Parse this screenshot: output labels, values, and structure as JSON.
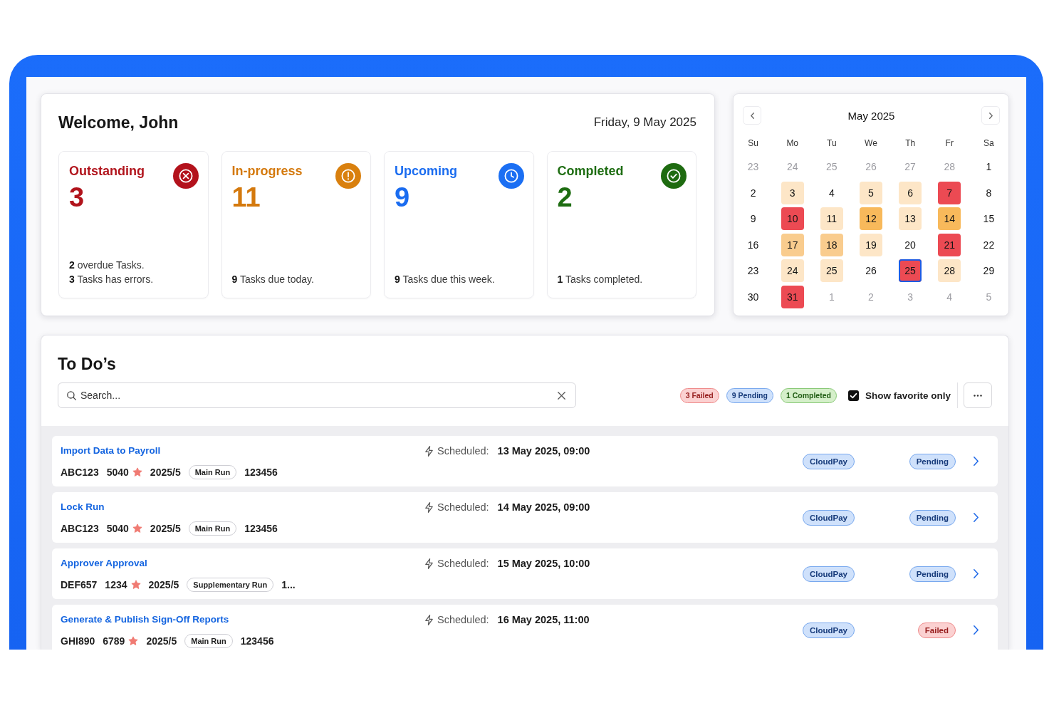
{
  "welcome": {
    "title": "Welcome, John",
    "date": "Friday, 9 May 2025",
    "stats": [
      {
        "kind": "outstanding",
        "label": "Outstanding",
        "value": "3",
        "notes": [
          "**2** overdue Tasks.",
          "**3** Tasks has errors."
        ]
      },
      {
        "kind": "in_progress",
        "label": "In-progress",
        "value": "11",
        "notes": [
          "**9** Tasks due today."
        ]
      },
      {
        "kind": "upcoming",
        "label": "Upcoming",
        "value": "9",
        "notes": [
          "**9** Tasks due this week."
        ]
      },
      {
        "kind": "completed",
        "label": "Completed",
        "value": "2",
        "notes": [
          "**1** Tasks completed."
        ]
      }
    ]
  },
  "calendar": {
    "title": "May 2025",
    "weekdays": [
      "Su",
      "Mo",
      "Tu",
      "We",
      "Th",
      "Fr",
      "Sa"
    ],
    "days": [
      {
        "day": "23",
        "outside": true,
        "selected": false
      },
      {
        "day": "24",
        "outside": true,
        "selected": false
      },
      {
        "day": "25",
        "outside": true,
        "selected": false
      },
      {
        "day": "26",
        "outside": true,
        "selected": false
      },
      {
        "day": "27",
        "outside": true,
        "selected": false
      },
      {
        "day": "28",
        "outside": true,
        "selected": false
      },
      {
        "day": "1",
        "outside": false,
        "selected": false
      },
      {
        "day": "2",
        "outside": false,
        "selected": false
      },
      {
        "day": "3",
        "outside": false,
        "selected": false,
        "color": "#fde6c7"
      },
      {
        "day": "4",
        "outside": false,
        "selected": false
      },
      {
        "day": "5",
        "outside": false,
        "selected": false,
        "color": "#fde6c7"
      },
      {
        "day": "6",
        "outside": false,
        "selected": false,
        "color": "#fde6c7"
      },
      {
        "day": "7",
        "outside": false,
        "selected": false,
        "color": "#ec4a53"
      },
      {
        "day": "8",
        "outside": false,
        "selected": false
      },
      {
        "day": "9",
        "outside": false,
        "selected": false
      },
      {
        "day": "10",
        "outside": false,
        "selected": false,
        "color": "#ec4a53"
      },
      {
        "day": "11",
        "outside": false,
        "selected": false,
        "color": "#fde6c7"
      },
      {
        "day": "12",
        "outside": false,
        "selected": false,
        "color": "#f8b95b"
      },
      {
        "day": "13",
        "outside": false,
        "selected": false,
        "color": "#fde6c7"
      },
      {
        "day": "14",
        "outside": false,
        "selected": false,
        "color": "#f8b95b"
      },
      {
        "day": "15",
        "outside": false,
        "selected": false
      },
      {
        "day": "16",
        "outside": false,
        "selected": false
      },
      {
        "day": "17",
        "outside": false,
        "selected": false,
        "color": "#f9cc8e"
      },
      {
        "day": "18",
        "outside": false,
        "selected": false,
        "color": "#f9cc8e"
      },
      {
        "day": "19",
        "outside": false,
        "selected": false,
        "color": "#fde6c7"
      },
      {
        "day": "20",
        "outside": false,
        "selected": false
      },
      {
        "day": "21",
        "outside": false,
        "selected": false,
        "color": "#ec4a53"
      },
      {
        "day": "22",
        "outside": false,
        "selected": false
      },
      {
        "day": "23",
        "outside": false,
        "selected": false
      },
      {
        "day": "24",
        "outside": false,
        "selected": false,
        "color": "#fde6c7"
      },
      {
        "day": "25",
        "outside": false,
        "selected": false,
        "color": "#fde6c7"
      },
      {
        "day": "26",
        "outside": false,
        "selected": false
      },
      {
        "day": "25",
        "outside": false,
        "selected": true,
        "color": "#ec4a53"
      },
      {
        "day": "28",
        "outside": false,
        "selected": false,
        "color": "#fde6c7"
      },
      {
        "day": "29",
        "outside": false,
        "selected": false
      },
      {
        "day": "30",
        "outside": false,
        "selected": false
      },
      {
        "day": "31",
        "outside": false,
        "selected": false,
        "color": "#ec4a53"
      },
      {
        "day": "1",
        "outside": true,
        "selected": false
      },
      {
        "day": "2",
        "outside": true,
        "selected": false
      },
      {
        "day": "3",
        "outside": true,
        "selected": false
      },
      {
        "day": "4",
        "outside": true,
        "selected": false
      },
      {
        "day": "5",
        "outside": true,
        "selected": false
      }
    ]
  },
  "todos": {
    "title": "To Do’s",
    "search": {
      "placeholder": "Search..."
    },
    "filters": [
      {
        "kind": "failed",
        "label": "3 Failed"
      },
      {
        "kind": "pending",
        "label": "9 Pending"
      },
      {
        "kind": "completed",
        "label": "1 Completed"
      }
    ],
    "favorite_only": {
      "label": "Show favorite only",
      "checked": true
    },
    "tasks": [
      {
        "title": "Import Data to Payroll",
        "code": "ABC123",
        "number": "5040",
        "favorite": true,
        "period": "2025/5",
        "run": "Main Run",
        "reference": "123456",
        "scheduled_label": "Scheduled:",
        "scheduled": "13 May 2025, 09:00",
        "system": "CloudPay",
        "status": {
          "kind": "pending",
          "label": "Pending"
        }
      },
      {
        "title": "Lock Run",
        "code": "ABC123",
        "number": "5040",
        "favorite": true,
        "period": "2025/5",
        "run": "Main Run",
        "reference": "123456",
        "scheduled_label": "Scheduled:",
        "scheduled": "14 May 2025, 09:00",
        "system": "CloudPay",
        "status": {
          "kind": "pending",
          "label": "Pending"
        }
      },
      {
        "title": "Approver Approval",
        "code": "DEF657",
        "number": "1234",
        "favorite": true,
        "period": "2025/5",
        "run": "Supplementary Run",
        "reference": "1...",
        "scheduled_label": "Scheduled:",
        "scheduled": "15 May 2025, 10:00",
        "system": "CloudPay",
        "status": {
          "kind": "pending",
          "label": "Pending"
        }
      },
      {
        "title": "Generate & Publish Sign-Off Reports",
        "code": "GHI890",
        "number": "6789",
        "favorite": true,
        "period": "2025/5",
        "run": "Main Run",
        "reference": "123456",
        "scheduled_label": "Scheduled:",
        "scheduled": "16 May 2025, 11:00",
        "system": "CloudPay",
        "status": {
          "kind": "failed",
          "label": "Failed"
        }
      }
    ]
  }
}
